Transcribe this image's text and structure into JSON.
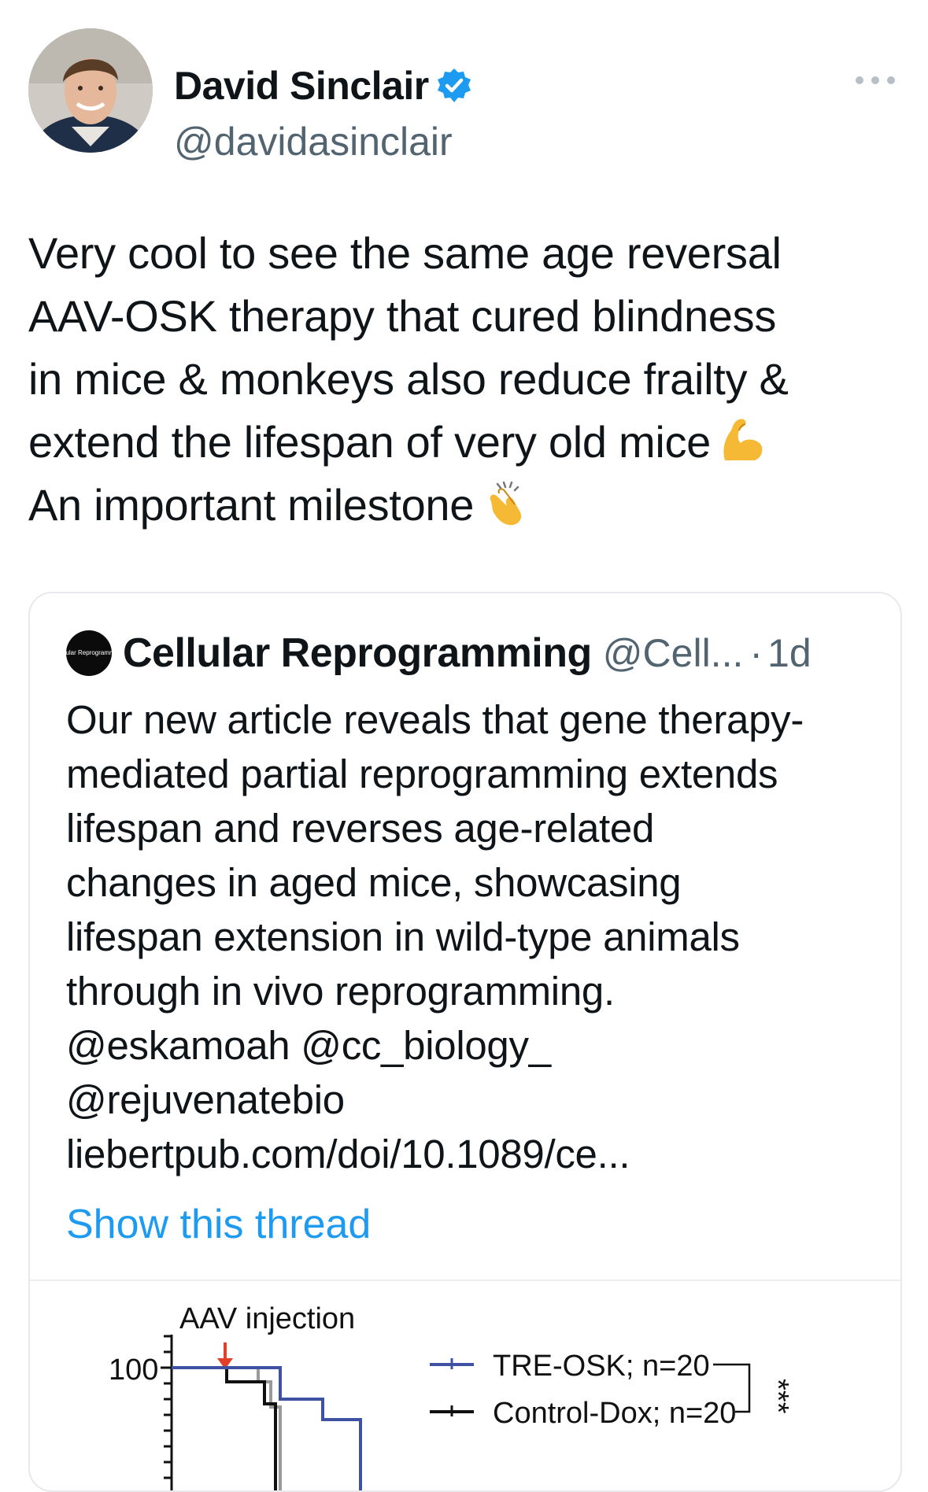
{
  "author": {
    "name": "David Sinclair",
    "handle": "@davidasinclair",
    "verified": true,
    "verified_color": "#1d9bf0"
  },
  "more_icon": "more-horizontal-icon",
  "tweet": {
    "lines": [
      "Very cool to see the same age reversal",
      "AAV-OSK therapy that cured blindness",
      "in mice & monkeys also reduce frailty &",
      "extend the lifespan of very old mice",
      "An important milestone"
    ],
    "emoji_1": "flexed-biceps-emoji",
    "emoji_2": "clapping-hands-emoji"
  },
  "quote": {
    "avatar_text": "Cellular Reprogramming",
    "name": "Cellular Reprogramming",
    "handle": "@Cell...",
    "separator": "·",
    "time": "1d",
    "lines": [
      "Our new article reveals that gene therapy-",
      "mediated partial reprogramming extends",
      "lifespan and reverses age-related",
      "changes in aged mice, showcasing",
      "lifespan extension in wild-type animals",
      "through in vivo reprogramming.",
      "@eskamoah @cc_biology_",
      "@rejuvenatebio",
      "liebertpub.com/doi/10.1089/ce..."
    ],
    "show_thread": "Show this thread",
    "link_color": "#1d9bf0"
  },
  "chart_data": {
    "type": "line",
    "annotation": "AAV injection",
    "y_tick_labels": [
      "100"
    ],
    "series": [
      {
        "name": "TRE-OSK; n=20",
        "color": "#3f51a3"
      },
      {
        "name": "Control-Dox; n=20",
        "color": "#111111"
      }
    ],
    "significance": "***"
  }
}
